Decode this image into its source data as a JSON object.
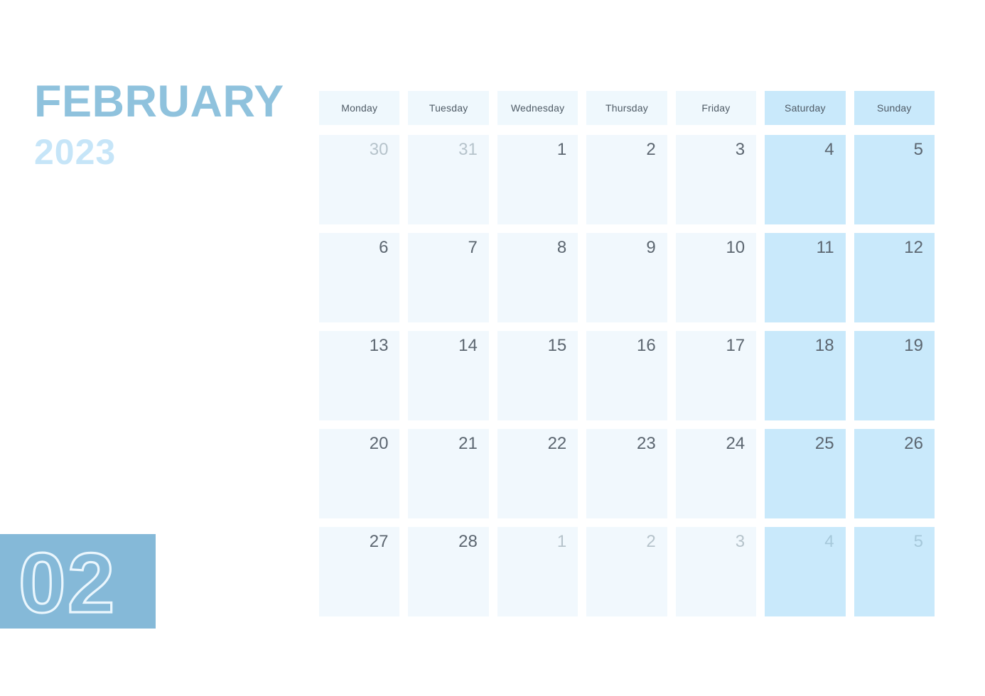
{
  "header": {
    "month_name": "FEBRUARY",
    "year": "2023",
    "month_number": "02"
  },
  "colors": {
    "month_title": "#8fc2dd",
    "year_title": "#c6e5f8",
    "badge_bg": "#85b9d8",
    "badge_outline": "#eaf6fd",
    "weekday_cell": "#f1f8fd",
    "weekend_cell": "#c9e9fb",
    "header_cell": "#eff8fd",
    "weekend_header_cell": "#c9e9fb",
    "date_text": "#5c6670",
    "other_month_text": "#b6c3cb",
    "page_bg": "#ffffff"
  },
  "weekdays": [
    {
      "label": "Monday",
      "weekend": false
    },
    {
      "label": "Tuesday",
      "weekend": false
    },
    {
      "label": "Wednesday",
      "weekend": false
    },
    {
      "label": "Thursday",
      "weekend": false
    },
    {
      "label": "Friday",
      "weekend": false
    },
    {
      "label": "Saturday",
      "weekend": true
    },
    {
      "label": "Sunday",
      "weekend": true
    }
  ],
  "weeks": [
    [
      {
        "day": "30",
        "current_month": false,
        "weekend": false
      },
      {
        "day": "31",
        "current_month": false,
        "weekend": false
      },
      {
        "day": "1",
        "current_month": true,
        "weekend": false
      },
      {
        "day": "2",
        "current_month": true,
        "weekend": false
      },
      {
        "day": "3",
        "current_month": true,
        "weekend": false
      },
      {
        "day": "4",
        "current_month": true,
        "weekend": true
      },
      {
        "day": "5",
        "current_month": true,
        "weekend": true
      }
    ],
    [
      {
        "day": "6",
        "current_month": true,
        "weekend": false
      },
      {
        "day": "7",
        "current_month": true,
        "weekend": false
      },
      {
        "day": "8",
        "current_month": true,
        "weekend": false
      },
      {
        "day": "9",
        "current_month": true,
        "weekend": false
      },
      {
        "day": "10",
        "current_month": true,
        "weekend": false
      },
      {
        "day": "11",
        "current_month": true,
        "weekend": true
      },
      {
        "day": "12",
        "current_month": true,
        "weekend": true
      }
    ],
    [
      {
        "day": "13",
        "current_month": true,
        "weekend": false
      },
      {
        "day": "14",
        "current_month": true,
        "weekend": false
      },
      {
        "day": "15",
        "current_month": true,
        "weekend": false
      },
      {
        "day": "16",
        "current_month": true,
        "weekend": false
      },
      {
        "day": "17",
        "current_month": true,
        "weekend": false
      },
      {
        "day": "18",
        "current_month": true,
        "weekend": true
      },
      {
        "day": "19",
        "current_month": true,
        "weekend": true
      }
    ],
    [
      {
        "day": "20",
        "current_month": true,
        "weekend": false
      },
      {
        "day": "21",
        "current_month": true,
        "weekend": false
      },
      {
        "day": "22",
        "current_month": true,
        "weekend": false
      },
      {
        "day": "23",
        "current_month": true,
        "weekend": false
      },
      {
        "day": "24",
        "current_month": true,
        "weekend": false
      },
      {
        "day": "25",
        "current_month": true,
        "weekend": true
      },
      {
        "day": "26",
        "current_month": true,
        "weekend": true
      }
    ],
    [
      {
        "day": "27",
        "current_month": true,
        "weekend": false
      },
      {
        "day": "28",
        "current_month": true,
        "weekend": false
      },
      {
        "day": "1",
        "current_month": false,
        "weekend": false
      },
      {
        "day": "2",
        "current_month": false,
        "weekend": false
      },
      {
        "day": "3",
        "current_month": false,
        "weekend": false
      },
      {
        "day": "4",
        "current_month": false,
        "weekend": true
      },
      {
        "day": "5",
        "current_month": false,
        "weekend": true
      }
    ]
  ]
}
